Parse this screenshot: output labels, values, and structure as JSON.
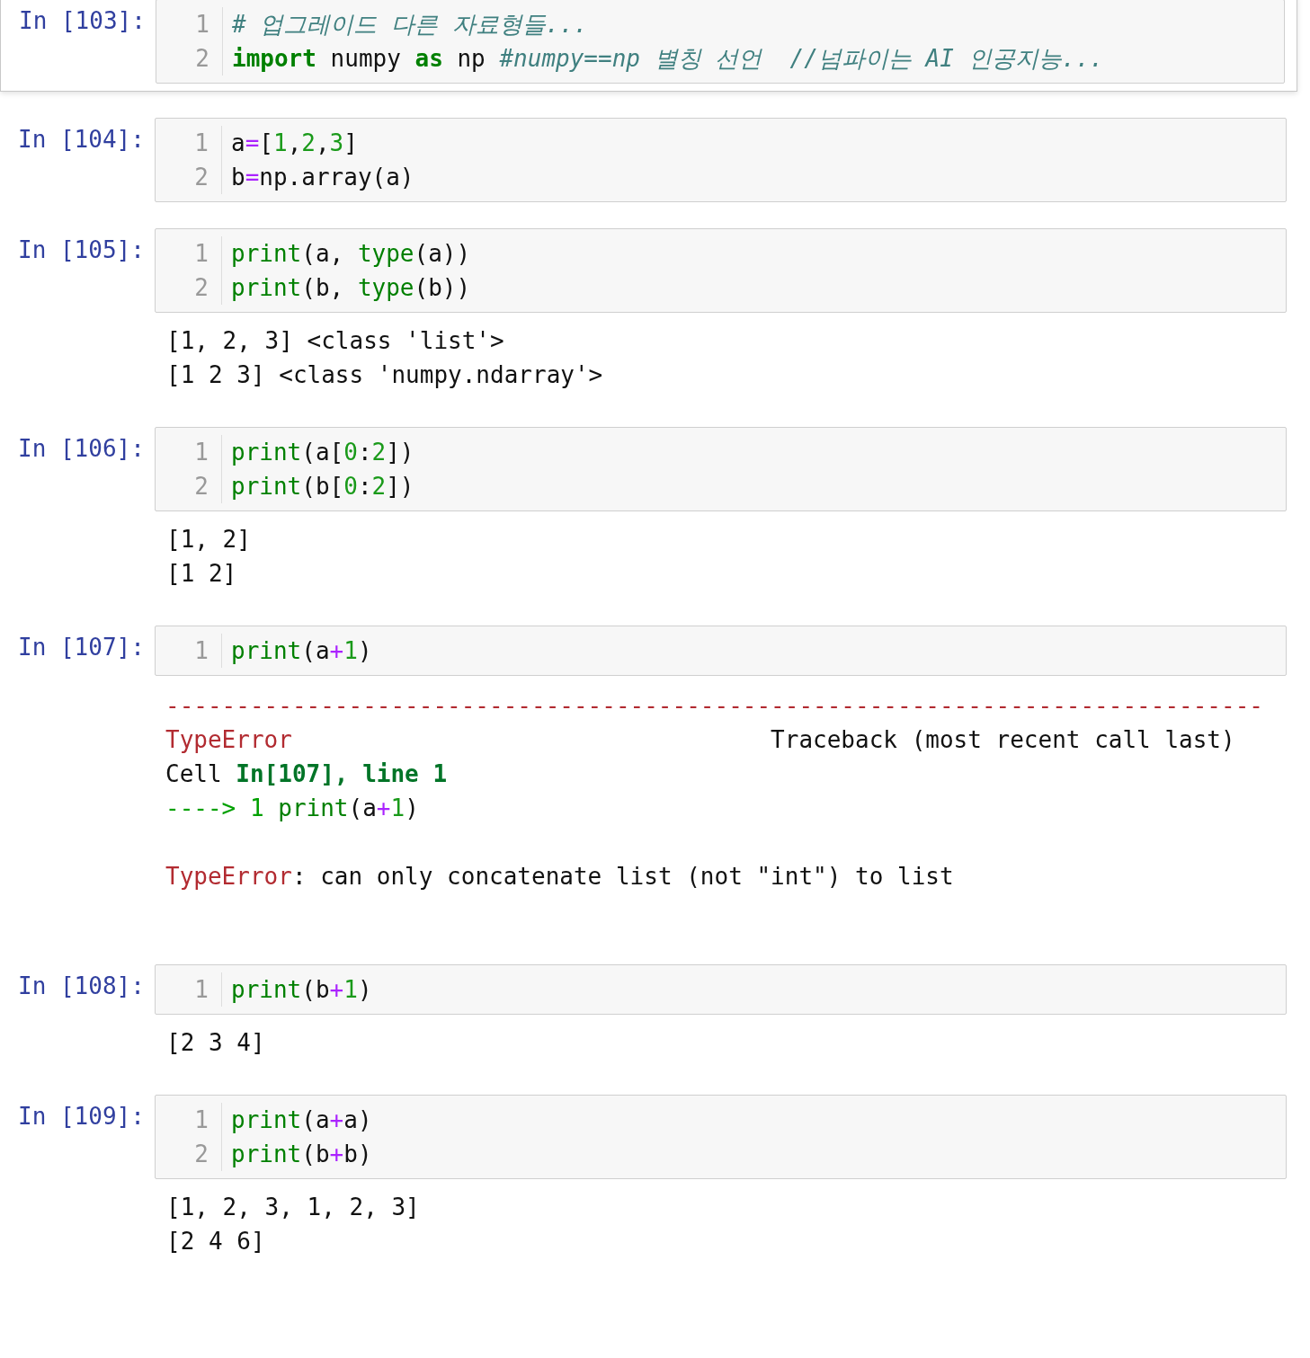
{
  "cells": [
    {
      "prompt": "In [103]:",
      "selected": true,
      "lines": [
        {
          "number": "1",
          "tokens": [
            {
              "kind": "comment",
              "text": "# 업그레이드 다른 자료형들..."
            }
          ]
        },
        {
          "number": "2",
          "tokens": [
            {
              "kind": "keyword",
              "text": "import"
            },
            {
              "kind": "text",
              "text": " numpy "
            },
            {
              "kind": "keyword",
              "text": "as"
            },
            {
              "kind": "text",
              "text": " np "
            },
            {
              "kind": "comment",
              "text": "#numpy==np 별칭 선언  //넘파이는 AI 인공지능..."
            }
          ]
        }
      ]
    },
    {
      "prompt": "In [104]:",
      "selected": false,
      "lines": [
        {
          "number": "1",
          "tokens": [
            {
              "kind": "text",
              "text": "a"
            },
            {
              "kind": "operator",
              "text": "="
            },
            {
              "kind": "text",
              "text": "["
            },
            {
              "kind": "number",
              "text": "1"
            },
            {
              "kind": "text",
              "text": ","
            },
            {
              "kind": "number",
              "text": "2"
            },
            {
              "kind": "text",
              "text": ","
            },
            {
              "kind": "number",
              "text": "3"
            },
            {
              "kind": "text",
              "text": "]"
            }
          ]
        },
        {
          "number": "2",
          "tokens": [
            {
              "kind": "text",
              "text": "b"
            },
            {
              "kind": "operator",
              "text": "="
            },
            {
              "kind": "text",
              "text": "np.array(a)"
            }
          ]
        }
      ]
    },
    {
      "prompt": "In [105]:",
      "selected": false,
      "lines": [
        {
          "number": "1",
          "tokens": [
            {
              "kind": "builtin",
              "text": "print"
            },
            {
              "kind": "text",
              "text": "(a, "
            },
            {
              "kind": "builtin",
              "text": "type"
            },
            {
              "kind": "text",
              "text": "(a))"
            }
          ]
        },
        {
          "number": "2",
          "tokens": [
            {
              "kind": "builtin",
              "text": "print"
            },
            {
              "kind": "text",
              "text": "(b, "
            },
            {
              "kind": "builtin",
              "text": "type"
            },
            {
              "kind": "text",
              "text": "(b))"
            }
          ]
        }
      ],
      "output": {
        "kind": "stream",
        "lines": [
          "[1, 2, 3] <class 'list'>",
          "[1 2 3] <class 'numpy.ndarray'>"
        ]
      }
    },
    {
      "prompt": "In [106]:",
      "selected": false,
      "lines": [
        {
          "number": "1",
          "tokens": [
            {
              "kind": "builtin",
              "text": "print"
            },
            {
              "kind": "text",
              "text": "(a["
            },
            {
              "kind": "number",
              "text": "0"
            },
            {
              "kind": "text",
              "text": ":"
            },
            {
              "kind": "number",
              "text": "2"
            },
            {
              "kind": "text",
              "text": "])"
            }
          ]
        },
        {
          "number": "2",
          "tokens": [
            {
              "kind": "builtin",
              "text": "print"
            },
            {
              "kind": "text",
              "text": "(b["
            },
            {
              "kind": "number",
              "text": "0"
            },
            {
              "kind": "text",
              "text": ":"
            },
            {
              "kind": "number",
              "text": "2"
            },
            {
              "kind": "text",
              "text": "])"
            }
          ]
        }
      ],
      "output": {
        "kind": "stream",
        "lines": [
          "[1, 2]",
          "[1 2]"
        ]
      }
    },
    {
      "prompt": "In [107]:",
      "selected": false,
      "lines": [
        {
          "number": "1",
          "tokens": [
            {
              "kind": "builtin",
              "text": "print"
            },
            {
              "kind": "text",
              "text": "(a"
            },
            {
              "kind": "operator",
              "text": "+"
            },
            {
              "kind": "number",
              "text": "1"
            },
            {
              "kind": "text",
              "text": ")"
            }
          ]
        }
      ],
      "output": {
        "kind": "error",
        "traceback": [
          [
            {
              "kind": "err",
              "text": "------------------------------------------------------------------------------"
            }
          ],
          [
            {
              "kind": "err",
              "text": "TypeError"
            },
            {
              "kind": "text",
              "text": "                                  Traceback (most recent call last)"
            }
          ],
          [
            {
              "kind": "text",
              "text": "Cell "
            },
            {
              "kind": "loc",
              "text": "In[107], line 1"
            }
          ],
          [
            {
              "kind": "ptr",
              "text": "----> 1 "
            },
            {
              "kind": "builtin",
              "text": "print"
            },
            {
              "kind": "text",
              "text": "(a"
            },
            {
              "kind": "operator",
              "text": "+"
            },
            {
              "kind": "number",
              "text": "1"
            },
            {
              "kind": "text",
              "text": ")"
            }
          ]
        ],
        "message": [
          {
            "kind": "err",
            "text": "TypeError"
          },
          {
            "kind": "text",
            "text": ": can only concatenate list (not \"int\") to list"
          }
        ]
      }
    },
    {
      "prompt": "In [108]:",
      "selected": false,
      "lines": [
        {
          "number": "1",
          "tokens": [
            {
              "kind": "builtin",
              "text": "print"
            },
            {
              "kind": "text",
              "text": "(b"
            },
            {
              "kind": "operator",
              "text": "+"
            },
            {
              "kind": "number",
              "text": "1"
            },
            {
              "kind": "text",
              "text": ")"
            }
          ]
        }
      ],
      "output": {
        "kind": "stream",
        "lines": [
          "[2 3 4]"
        ]
      }
    },
    {
      "prompt": "In [109]:",
      "selected": false,
      "lines": [
        {
          "number": "1",
          "tokens": [
            {
              "kind": "builtin",
              "text": "print"
            },
            {
              "kind": "text",
              "text": "(a"
            },
            {
              "kind": "operator",
              "text": "+"
            },
            {
              "kind": "text",
              "text": "a)"
            }
          ]
        },
        {
          "number": "2",
          "tokens": [
            {
              "kind": "builtin",
              "text": "print"
            },
            {
              "kind": "text",
              "text": "(b"
            },
            {
              "kind": "operator",
              "text": "+"
            },
            {
              "kind": "text",
              "text": "b)"
            }
          ]
        }
      ],
      "output": {
        "kind": "stream",
        "lines": [
          "[1, 2, 3, 1, 2, 3]",
          "[2 4 6]"
        ]
      }
    }
  ]
}
